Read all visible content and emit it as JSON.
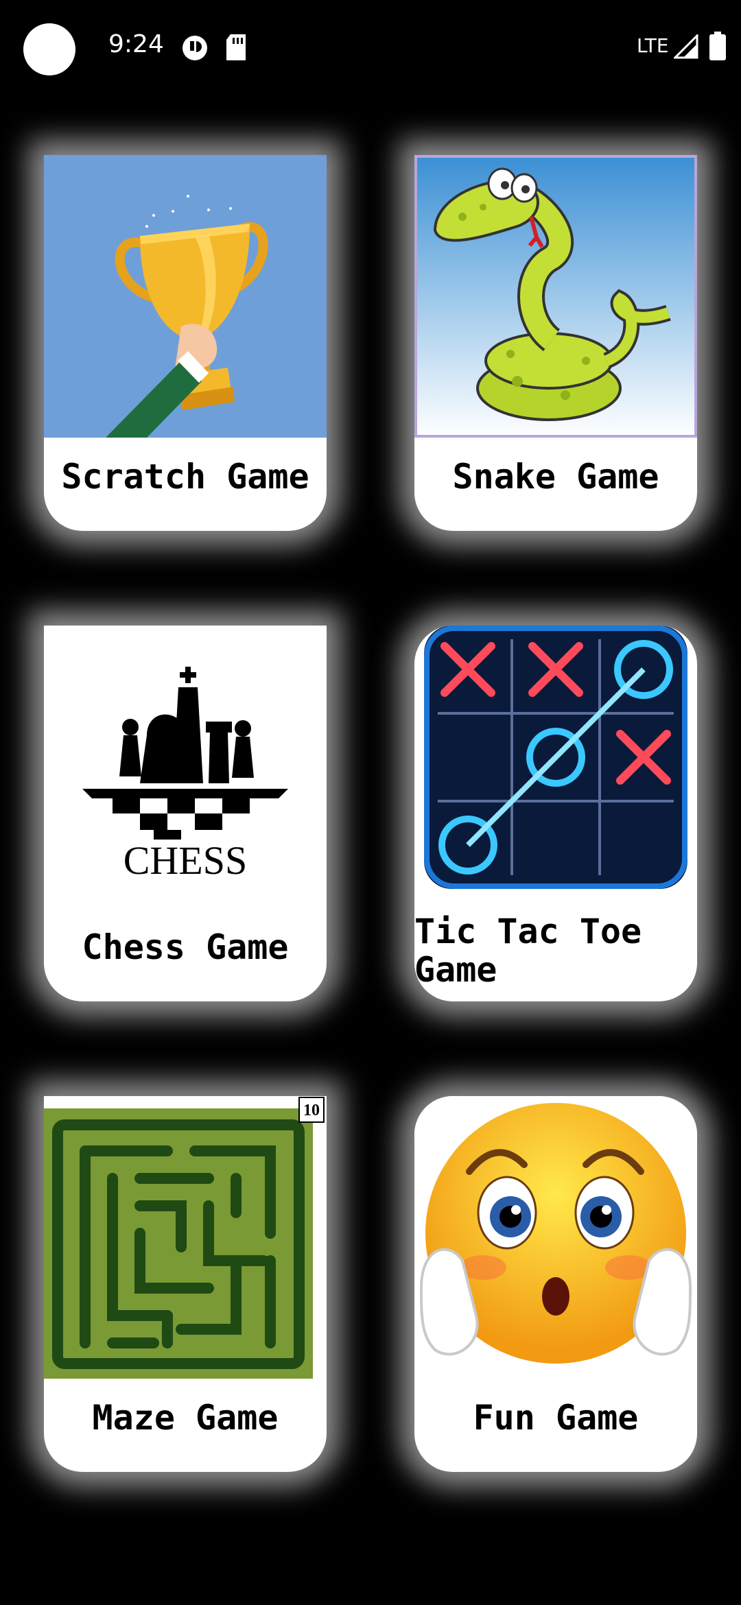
{
  "status_bar": {
    "time": "9:24",
    "network": "LTE",
    "icons": [
      "notification-icon",
      "sd-card-icon",
      "signal-icon",
      "battery-icon"
    ]
  },
  "games": [
    {
      "label": "Scratch Game",
      "image": "trophy-image"
    },
    {
      "label": "Snake Game",
      "image": "snake-image"
    },
    {
      "label": "Chess Game",
      "image": "chess-image",
      "image_text": "CHESS"
    },
    {
      "label": "Tic Tac Toe Game",
      "image": "tic-tac-toe-image"
    },
    {
      "label": "Maze Game",
      "image": "maze-image",
      "badge": "10"
    },
    {
      "label": "Fun Game",
      "image": "emoji-image"
    }
  ],
  "colors": {
    "background": "#000000",
    "card": "#ffffff",
    "glow": "#ffffff"
  }
}
